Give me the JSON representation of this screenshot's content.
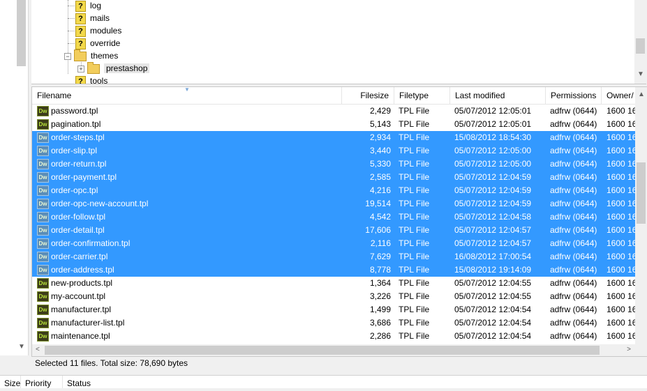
{
  "tree": {
    "items": [
      {
        "label": "log",
        "icon": "unknown-folder-icon"
      },
      {
        "label": "mails",
        "icon": "unknown-folder-icon"
      },
      {
        "label": "modules",
        "icon": "unknown-folder-icon"
      },
      {
        "label": "override",
        "icon": "unknown-folder-icon"
      },
      {
        "label": "themes",
        "icon": "folder-icon",
        "expanded": true
      },
      {
        "label": "prestashop",
        "icon": "folder-icon",
        "selected": true
      },
      {
        "label": "tools",
        "icon": "unknown-folder-icon"
      }
    ]
  },
  "filelist": {
    "columns": [
      "Filename",
      "Filesize",
      "Filetype",
      "Last modified",
      "Permissions",
      "Owner/"
    ],
    "rows": [
      {
        "name": "password.tpl",
        "size": "2,429",
        "type": "TPL File",
        "modified": "05/07/2012 12:05:01",
        "perms": "adfrw (0644)",
        "owner": "1600 16",
        "selected": false
      },
      {
        "name": "pagination.tpl",
        "size": "5,143",
        "type": "TPL File",
        "modified": "05/07/2012 12:05:01",
        "perms": "adfrw (0644)",
        "owner": "1600 16",
        "selected": false
      },
      {
        "name": "order-steps.tpl",
        "size": "2,934",
        "type": "TPL File",
        "modified": "15/08/2012 18:54:30",
        "perms": "adfrw (0644)",
        "owner": "1600 16",
        "selected": true
      },
      {
        "name": "order-slip.tpl",
        "size": "3,440",
        "type": "TPL File",
        "modified": "05/07/2012 12:05:00",
        "perms": "adfrw (0644)",
        "owner": "1600 16",
        "selected": true
      },
      {
        "name": "order-return.tpl",
        "size": "5,330",
        "type": "TPL File",
        "modified": "05/07/2012 12:05:00",
        "perms": "adfrw (0644)",
        "owner": "1600 16",
        "selected": true
      },
      {
        "name": "order-payment.tpl",
        "size": "2,585",
        "type": "TPL File",
        "modified": "05/07/2012 12:04:59",
        "perms": "adfrw (0644)",
        "owner": "1600 16",
        "selected": true
      },
      {
        "name": "order-opc.tpl",
        "size": "4,216",
        "type": "TPL File",
        "modified": "05/07/2012 12:04:59",
        "perms": "adfrw (0644)",
        "owner": "1600 16",
        "selected": true
      },
      {
        "name": "order-opc-new-account.tpl",
        "size": "19,514",
        "type": "TPL File",
        "modified": "05/07/2012 12:04:59",
        "perms": "adfrw (0644)",
        "owner": "1600 16",
        "selected": true
      },
      {
        "name": "order-follow.tpl",
        "size": "4,542",
        "type": "TPL File",
        "modified": "05/07/2012 12:04:58",
        "perms": "adfrw (0644)",
        "owner": "1600 16",
        "selected": true
      },
      {
        "name": "order-detail.tpl",
        "size": "17,606",
        "type": "TPL File",
        "modified": "05/07/2012 12:04:57",
        "perms": "adfrw (0644)",
        "owner": "1600 16",
        "selected": true
      },
      {
        "name": "order-confirmation.tpl",
        "size": "2,116",
        "type": "TPL File",
        "modified": "05/07/2012 12:04:57",
        "perms": "adfrw (0644)",
        "owner": "1600 16",
        "selected": true
      },
      {
        "name": "order-carrier.tpl",
        "size": "7,629",
        "type": "TPL File",
        "modified": "16/08/2012 17:00:54",
        "perms": "adfrw (0644)",
        "owner": "1600 16",
        "selected": true
      },
      {
        "name": "order-address.tpl",
        "size": "8,778",
        "type": "TPL File",
        "modified": "15/08/2012 19:14:09",
        "perms": "adfrw (0644)",
        "owner": "1600 16",
        "selected": true
      },
      {
        "name": "new-products.tpl",
        "size": "1,364",
        "type": "TPL File",
        "modified": "05/07/2012 12:04:55",
        "perms": "adfrw (0644)",
        "owner": "1600 16",
        "selected": false
      },
      {
        "name": "my-account.tpl",
        "size": "3,226",
        "type": "TPL File",
        "modified": "05/07/2012 12:04:55",
        "perms": "adfrw (0644)",
        "owner": "1600 16",
        "selected": false
      },
      {
        "name": "manufacturer.tpl",
        "size": "1,499",
        "type": "TPL File",
        "modified": "05/07/2012 12:04:54",
        "perms": "adfrw (0644)",
        "owner": "1600 16",
        "selected": false
      },
      {
        "name": "manufacturer-list.tpl",
        "size": "3,686",
        "type": "TPL File",
        "modified": "05/07/2012 12:04:54",
        "perms": "adfrw (0644)",
        "owner": "1600 16",
        "selected": false
      },
      {
        "name": "maintenance.tpl",
        "size": "2,286",
        "type": "TPL File",
        "modified": "05/07/2012 12:04:54",
        "perms": "adfrw (0644)",
        "owner": "1600 16",
        "selected": false
      }
    ],
    "file_icon_text": "Dw"
  },
  "status": {
    "text": "Selected 11 files. Total size: 78,690 bytes"
  },
  "queue": {
    "columns": [
      "Size",
      "Priority",
      "Status"
    ]
  },
  "colors": {
    "selection": "#3399ff",
    "panel_bg": "#ffffff",
    "chrome_bg": "#f0f0f0"
  }
}
